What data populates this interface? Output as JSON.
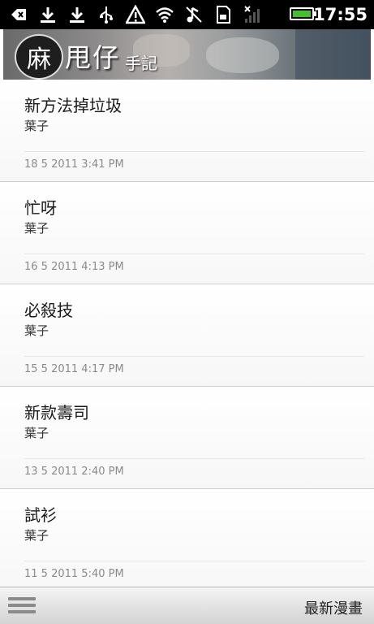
{
  "statusbar": {
    "icons": [
      "back-arrow-icon",
      "download-icon",
      "download-icon",
      "usb-icon",
      "warning-icon",
      "wifi-icon",
      "music-off-icon",
      "sd-card-icon",
      "no-signal-icon"
    ],
    "time": "17:55"
  },
  "banner": {
    "logo_glyph": "麻",
    "logo_text": "甩仔",
    "logo_small": "手記"
  },
  "posts": [
    {
      "title": "新方法掉垃圾",
      "author": "葉子",
      "date": "18 5 2011 3:41 PM"
    },
    {
      "title": "忙呀",
      "author": "葉子",
      "date": "16 5 2011 4:13 PM"
    },
    {
      "title": "必殺技",
      "author": "葉子",
      "date": "15 5 2011 4:17 PM"
    },
    {
      "title": "新款壽司",
      "author": "葉子",
      "date": "13 5 2011 2:40 PM"
    },
    {
      "title": "試衫",
      "author": "葉子",
      "date": "11 5 2011 5:40 PM"
    }
  ],
  "bottombar": {
    "latest_label": "最新漫畫"
  }
}
